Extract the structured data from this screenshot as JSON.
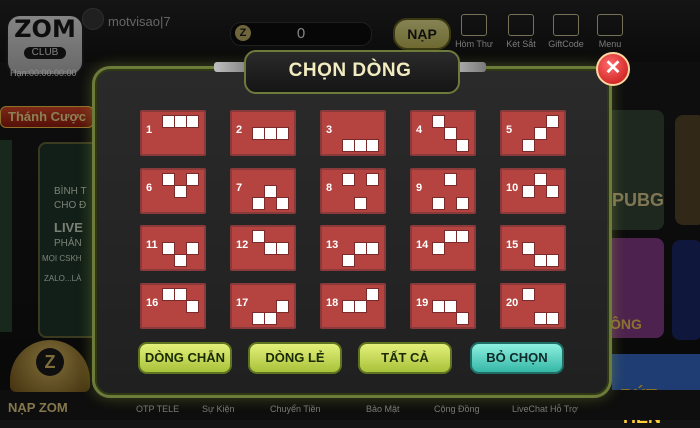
{
  "header": {
    "logo_text": "ZOM",
    "logo_sub": "CLUB",
    "clock": "Hạn:00:00:00:00",
    "username": "motvisao|7",
    "coins": "0",
    "nap_label": "NẠP",
    "icons": [
      {
        "name": "mail-icon",
        "label": "Hòm Thư"
      },
      {
        "name": "safe-icon",
        "label": "Két Sắt"
      },
      {
        "name": "giftcode-icon",
        "label": "GiftCode"
      },
      {
        "name": "menu-icon",
        "label": "Menu"
      }
    ]
  },
  "promo": {
    "label": "Thánh Cược"
  },
  "left_card": {
    "lines": [
      "BÌNH T",
      "CHO Đ",
      "LIVE",
      "PHẢN",
      "MỌI CSKH",
      "ZALO...LÀ"
    ]
  },
  "right_cards": {
    "pubg": "PUBG",
    "game2": "ÔNG",
    "game3": "RÚT TIỀN"
  },
  "bottom_nav": [
    "NẠP ZOM",
    "OTP TELE",
    "Sự Kiện",
    "Chuyển Tiền",
    "Bảo Mật",
    "Cộng Đồng",
    "LiveChat Hỗ Trợ"
  ],
  "dialog": {
    "title": "CHỌN DÒNG",
    "close_label": "✕",
    "lines": [
      "1",
      "2",
      "3",
      "4",
      "5",
      "6",
      "7",
      "8",
      "9",
      "10",
      "11",
      "12",
      "13",
      "14",
      "15",
      "16",
      "17",
      "18",
      "19",
      "20"
    ],
    "buttons": [
      "DÒNG CHẴN",
      "DÒNG LẺ",
      "TẤT CẢ",
      "BỎ CHỌN"
    ]
  },
  "colors": {
    "cell_red": "#b5433f",
    "button_green": "#c8dc5a",
    "button_teal": "#5fd8c6",
    "frame_olive": "#6c7a3a"
  }
}
